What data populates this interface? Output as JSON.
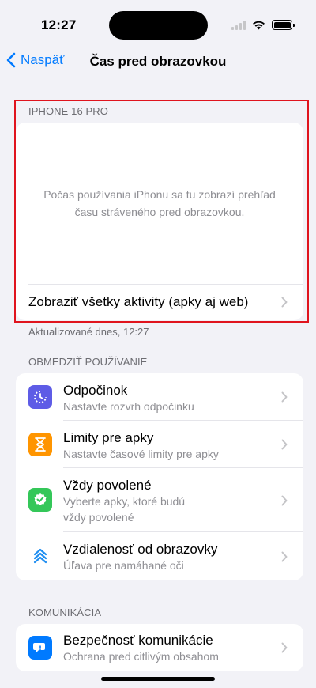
{
  "status": {
    "time": "12:27"
  },
  "nav": {
    "back_label": "Naspäť",
    "title": "Čas pred obrazovkou"
  },
  "device_section": {
    "header": "IPHONE 16 PRO",
    "placeholder": "Počas používania iPhonu sa tu zobrazí prehľad času stráveného pred obrazovkou.",
    "activity_label": "Zobraziť všetky aktivity (apky aj web)",
    "updated_note": "Aktualizované dnes, 12:27"
  },
  "limit_section": {
    "header": "OBMEDZIŤ POUŽÍVANIE",
    "items": [
      {
        "title": "Odpočinok",
        "subtitle": "Nastavte rozvrh odpočinku",
        "icon": "downtime-icon",
        "color": "#5e5ce6"
      },
      {
        "title": "Limity pre apky",
        "subtitle": "Nastavte časové limity pre apky",
        "icon": "hourglass-icon",
        "color": "#ff9500"
      },
      {
        "title": "Vždy povolené",
        "subtitle_line1": "Vyberte apky, ktoré budú",
        "subtitle_line2": "vždy povolené",
        "icon": "checkmark-shield-icon",
        "color": "#34c759"
      },
      {
        "title": "Vzdialenosť od obrazovky",
        "subtitle": "Úľava pre namáhané oči",
        "icon": "chevrons-up-icon",
        "color": "#ffffff"
      }
    ]
  },
  "communication_section": {
    "header": "KOMUNIKÁCIA",
    "items": [
      {
        "title": "Bezpečnosť komunikácie",
        "subtitle": "Ochrana pred citlivým obsahom",
        "icon": "chat-bubble-icon",
        "color": "#007aff"
      }
    ]
  },
  "colors": {
    "accent": "#007aff",
    "highlight_border": "#e0141e",
    "background": "#f2f2f7"
  }
}
